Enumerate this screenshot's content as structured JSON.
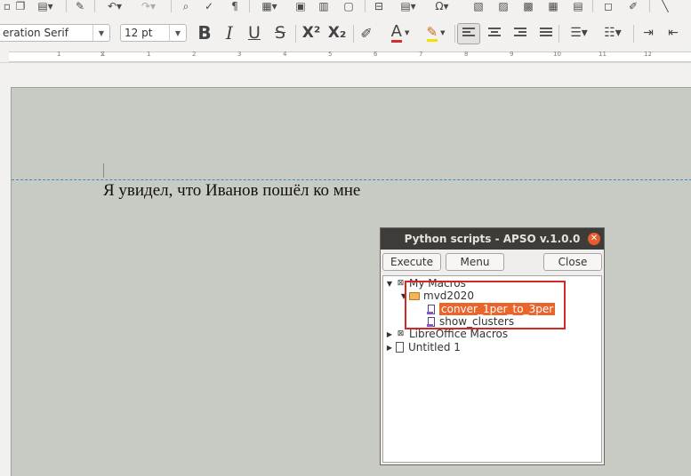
{
  "toolbar": {
    "font_name": "eration Serif",
    "font_size": "12 pt",
    "bold_label": "B",
    "italic_label": "I",
    "underline_label": "U",
    "strike_label": "S",
    "superscript_label": "X²",
    "subscript_label": "X₂",
    "accent_color": "#e9652b"
  },
  "ruler": {
    "numbers": [
      "1",
      "1",
      "2",
      "3",
      "4",
      "5",
      "6",
      "7",
      "8",
      "9",
      "10",
      "11",
      "12"
    ]
  },
  "document": {
    "text": "Я увидел, что Иванов пошёл ко мне"
  },
  "dialog": {
    "title": "Python scripts - APSO v.1.0.0",
    "execute_label": "Execute",
    "menu_label": "Menu",
    "close_label": "Close",
    "tree": {
      "my_macros": "My Macros",
      "folder": "mvd2020",
      "script_selected": "conver_1per_to_3per",
      "script_other": "show_clusters",
      "libreoffice_macros": "LibreOffice Macros",
      "untitled": "Untitled 1"
    }
  }
}
